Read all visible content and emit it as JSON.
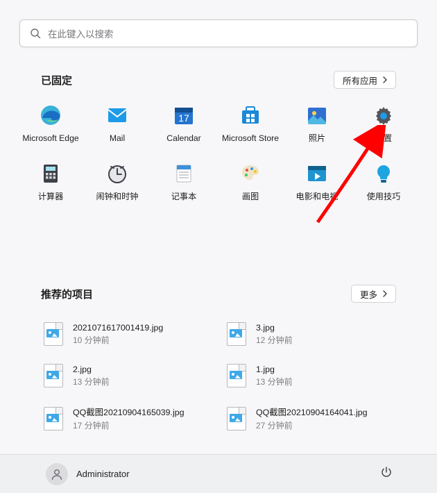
{
  "search": {
    "placeholder": "在此键入以搜索"
  },
  "pinned": {
    "title": "已固定",
    "all_apps_label": "所有应用",
    "apps": [
      {
        "id": "edge",
        "label": "Microsoft Edge"
      },
      {
        "id": "mail",
        "label": "Mail"
      },
      {
        "id": "calendar",
        "label": "Calendar"
      },
      {
        "id": "store",
        "label": "Microsoft Store"
      },
      {
        "id": "photos",
        "label": "照片"
      },
      {
        "id": "settings",
        "label": "设置"
      },
      {
        "id": "calc",
        "label": "计算器"
      },
      {
        "id": "clock",
        "label": "闹钟和时钟"
      },
      {
        "id": "notepad",
        "label": "记事本"
      },
      {
        "id": "paint",
        "label": "画图"
      },
      {
        "id": "movies",
        "label": "电影和电视"
      },
      {
        "id": "tips",
        "label": "使用技巧"
      }
    ]
  },
  "recommended": {
    "title": "推荐的项目",
    "more_label": "更多",
    "items": [
      {
        "name": "2021071617001419.jpg",
        "time": "10 分钟前"
      },
      {
        "name": "3.jpg",
        "time": "12 分钟前"
      },
      {
        "name": "2.jpg",
        "time": "13 分钟前"
      },
      {
        "name": "1.jpg",
        "time": "13 分钟前"
      },
      {
        "name": "QQ截图20210904165039.jpg",
        "time": "17 分钟前"
      },
      {
        "name": "QQ截图20210904164041.jpg",
        "time": "27 分钟前"
      }
    ]
  },
  "user": {
    "name": "Administrator"
  }
}
